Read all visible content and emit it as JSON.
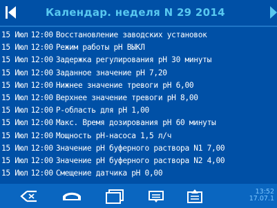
{
  "header": {
    "title": "Календар. неделя N 29 2014",
    "prev_icon": "prev-icon",
    "next_icon": "next-icon"
  },
  "log": {
    "rows": [
      {
        "date": "15 Июл",
        "time": "12:00",
        "text": "Восстановление заводских установок"
      },
      {
        "date": "15 Июл",
        "time": "12:00",
        "text": "Режим работы pH ВЫКЛ"
      },
      {
        "date": "15 Июл",
        "time": "12:00",
        "text": "Задержка регулирования pH 30 минуты"
      },
      {
        "date": "15 Июл",
        "time": "12:00",
        "text": "Заданное значение pH 7,20"
      },
      {
        "date": "15 Июл",
        "time": "12:00",
        "text": "Нижнее значение тревоги pH 6,00"
      },
      {
        "date": "15 Июл",
        "time": "12:00",
        "text": "Верхнее значение тревоги pH 8,00"
      },
      {
        "date": "15 Июл",
        "time": "12:00",
        "text": "P-область для pH 1,00"
      },
      {
        "date": "15 Июл",
        "time": "12:00",
        "text": "Макс. Время дозирования pH 60 минуты"
      },
      {
        "date": "15 Июл",
        "time": "12:00",
        "text": "Мощность pH-насоса 1,5 л/ч"
      },
      {
        "date": "15 Июл",
        "time": "12:00",
        "text": "Значение pH буферного раствора N1 7,00"
      },
      {
        "date": "15 Июл",
        "time": "12:00",
        "text": "Значение pH буферного раствора N2 4,00"
      },
      {
        "date": "15 Июл",
        "time": "12:00",
        "text": "Смещение датчика pH 0,00"
      }
    ]
  },
  "footer": {
    "icons": [
      "back-icon",
      "home-icon",
      "window-icon",
      "menu-icon",
      "upload-icon"
    ],
    "clock_time": "13:52",
    "clock_date": "17.07.1"
  },
  "colors": {
    "background": "#0050a6",
    "title": "#58c8f0",
    "footer": "#0a66c0",
    "icon": "#ffffff"
  }
}
